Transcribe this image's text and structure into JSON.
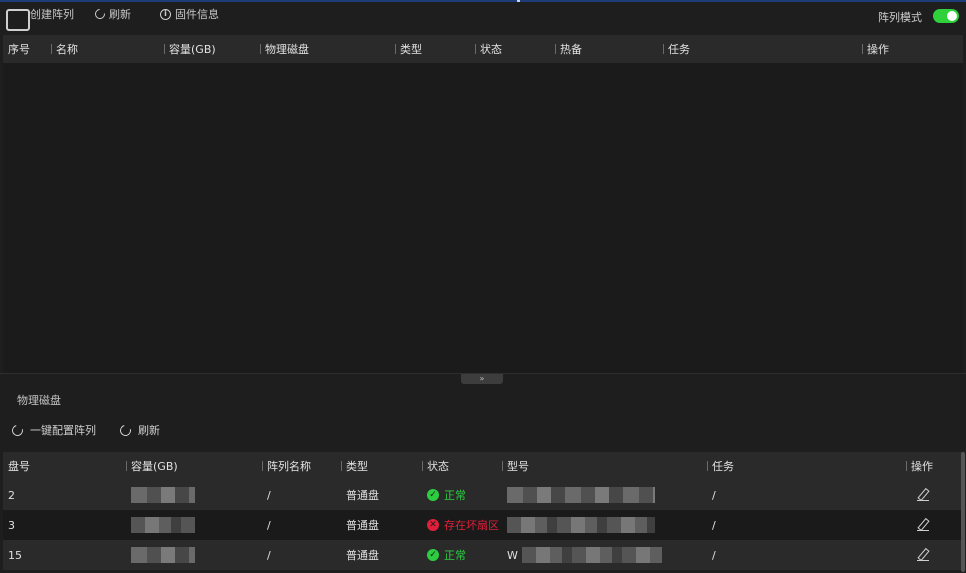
{
  "toolbar": {
    "create_label": "创建阵列",
    "refresh_label": "刷新",
    "firmware_label": "固件信息",
    "array_mode_label": "阵列模式",
    "array_mode_on": true
  },
  "array_table": {
    "columns": [
      "序号",
      "名称",
      "容量(GB)",
      "物理磁盘",
      "类型",
      "状态",
      "热备",
      "任务",
      "操作"
    ],
    "rows": []
  },
  "collapse_glyph": "»",
  "physical_disks": {
    "title": "物理磁盘",
    "one_click_label": "一键配置阵列",
    "refresh_label": "刷新",
    "columns": [
      "盘号",
      "容量(GB)",
      "阵列名称",
      "类型",
      "状态",
      "型号",
      "任务",
      "操作"
    ],
    "rows": [
      {
        "no": "2",
        "array": "/",
        "type": "普通盘",
        "status": "正常",
        "status_kind": "ok",
        "model_prefix": "",
        "task": "/"
      },
      {
        "no": "3",
        "array": "/",
        "type": "普通盘",
        "status": "存在坏扇区",
        "status_kind": "bad",
        "model_prefix": "",
        "task": "/"
      },
      {
        "no": "15",
        "array": "/",
        "type": "普通盘",
        "status": "正常",
        "status_kind": "ok",
        "model_prefix": "W",
        "task": "/"
      }
    ]
  },
  "colors": {
    "accent_green": "#2ecc40",
    "error_red": "#e0203a",
    "topline": "#1e3c78"
  }
}
